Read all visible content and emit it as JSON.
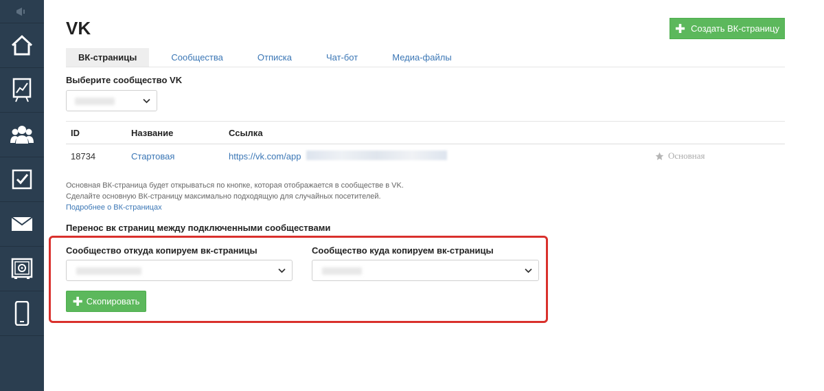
{
  "sidebar": {
    "items": [
      {
        "icon": "home-icon"
      },
      {
        "icon": "chart-icon"
      },
      {
        "icon": "users-icon"
      },
      {
        "icon": "checkbox-icon"
      },
      {
        "icon": "mail-icon"
      },
      {
        "icon": "safe-icon"
      },
      {
        "icon": "phone-icon"
      }
    ]
  },
  "page": {
    "title": "VK",
    "create_button": "Создать ВК-страницу"
  },
  "tabs": [
    {
      "label": "ВК-страницы",
      "active": true
    },
    {
      "label": "Сообщества",
      "active": false
    },
    {
      "label": "Отписка",
      "active": false
    },
    {
      "label": "Чат-бот",
      "active": false
    },
    {
      "label": "Медиа-файлы",
      "active": false
    }
  ],
  "community_select": {
    "label": "Выберите сообщество VK"
  },
  "table": {
    "headers": {
      "id": "ID",
      "name": "Название",
      "link": "Ссылка"
    },
    "rows": [
      {
        "id": "18734",
        "name": "Стартовая",
        "link": "https://vk.com/app",
        "badge": "Основная"
      }
    ]
  },
  "note": {
    "line1": "Основная ВК-страница будет открываться по кнопке, которая отображается в сообществе в VK.",
    "line2": "Сделайте основную ВК-страницу максимально подходящую для случайных посетителей.",
    "link": "Подробнее о ВК-страницах"
  },
  "transfer": {
    "heading": "Перенос вк страниц между подключенными сообществами",
    "from_label": "Сообщество откуда копируем вк-страницы",
    "to_label": "Сообщество куда копируем вк-страницы",
    "copy_button": "Скопировать"
  },
  "colors": {
    "sidebar_bg": "#2b3e50",
    "green": "#5cb85c",
    "link": "#3a76b5",
    "highlight": "#d9302c"
  }
}
